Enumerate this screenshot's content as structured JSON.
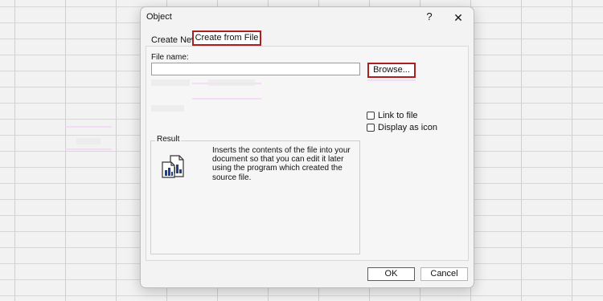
{
  "dialog": {
    "title": "Object",
    "help_symbol": "?",
    "close_symbol": "✕"
  },
  "tabs": [
    {
      "label": "Create New"
    },
    {
      "label": "Create from File"
    }
  ],
  "file_name": {
    "label": "File name:",
    "value": "",
    "browse_label": "Browse..."
  },
  "options": {
    "link_to_file": "Link to file",
    "display_as_icon": "Display as icon"
  },
  "result": {
    "label": "Result",
    "text": "Inserts the contents of the file into your\ndocument so that you can edit it later\nusing the program which created the\nsource file."
  },
  "buttons": {
    "ok": "OK",
    "cancel": "Cancel"
  },
  "icons": {
    "result": "document-chart-icon"
  },
  "colors": {
    "highlight_border": "#ad1f1f",
    "primary_button_border": "#2a63bf"
  }
}
